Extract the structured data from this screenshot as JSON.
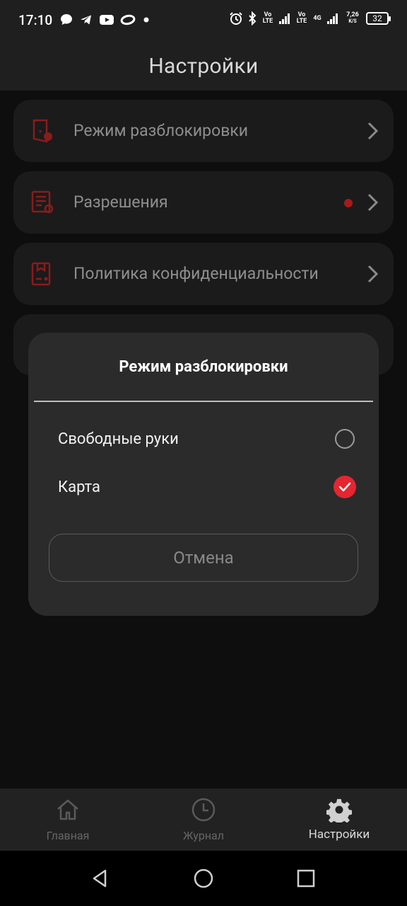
{
  "status_bar": {
    "time": "17:10",
    "network_speed_value": "7,26",
    "network_speed_unit": "K/S",
    "battery": "32",
    "volte_1": "Vo LTE",
    "volte_2": "Vo LTE",
    "net_type": "4G"
  },
  "header": {
    "title": "Настройки"
  },
  "settings_items": [
    {
      "label": "Режим разблокировки",
      "icon": "door-icon"
    },
    {
      "label": "Разрешения",
      "icon": "permissions-icon",
      "has_notification_dot": true
    },
    {
      "label": "Политика конфиденциальности",
      "icon": "privacy-icon"
    }
  ],
  "dialog": {
    "title": "Режим разблокировки",
    "options": [
      {
        "label": "Свободные руки",
        "selected": false
      },
      {
        "label": "Карта",
        "selected": true
      }
    ],
    "cancel_label": "Отмена"
  },
  "bottom_nav": [
    {
      "label": "Главная",
      "icon": "home-icon",
      "active": false
    },
    {
      "label": "Журнал",
      "icon": "clock-icon",
      "active": false
    },
    {
      "label": "Настройки",
      "icon": "gear-icon",
      "active": true
    }
  ],
  "colors": {
    "accent": "#e3262f",
    "dialog_bg": "#2b2b2b",
    "background": "#0e0e0e"
  }
}
